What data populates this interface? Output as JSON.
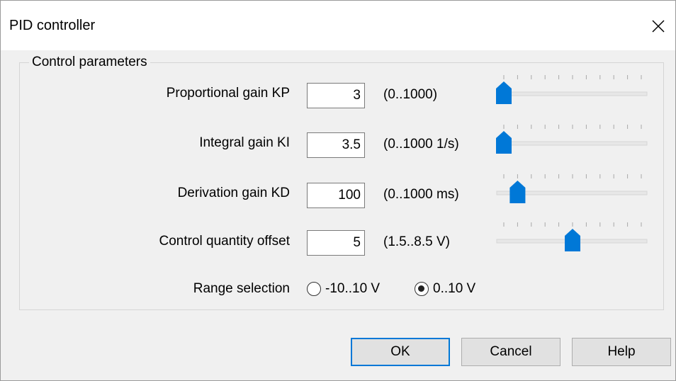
{
  "window": {
    "title": "PID controller"
  },
  "group": {
    "title": "Control parameters"
  },
  "params": [
    {
      "label": "Proportional gain KP",
      "value": "3",
      "range": "(0..1000)",
      "slider_fraction": 0.0
    },
    {
      "label": "Integral gain KI",
      "value": "3.5",
      "range": "(0..1000  1/s)",
      "slider_fraction": 0.0
    },
    {
      "label": "Derivation gain KD",
      "value": "100",
      "range": "(0..1000 ms)",
      "slider_fraction": 0.1
    },
    {
      "label": "Control quantity offset",
      "value": "5",
      "range": "(1.5..8.5 V)",
      "slider_fraction": 0.5
    }
  ],
  "range_selection": {
    "label": "Range selection",
    "options": [
      {
        "label": "-10..10 V",
        "selected": false
      },
      {
        "label": "0..10 V",
        "selected": true
      }
    ]
  },
  "buttons": {
    "ok": "OK",
    "cancel": "Cancel",
    "help": "Help"
  },
  "colors": {
    "accent": "#0078d7",
    "thumb": "#0078d7",
    "track": "#e7e7e7"
  },
  "icons": {
    "close": "close-icon"
  }
}
